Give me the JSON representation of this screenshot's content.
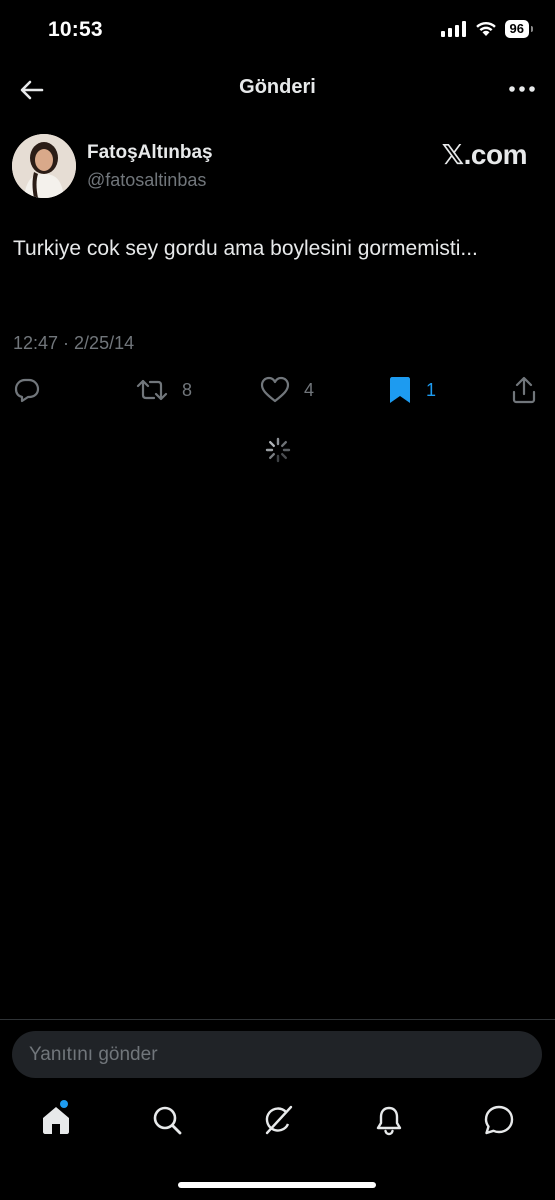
{
  "status_bar": {
    "time": "10:53",
    "battery": "96"
  },
  "header": {
    "title": "Gönderi"
  },
  "post": {
    "author_name": "FatoşAltınbaş",
    "author_handle": "@fatosaltinbas",
    "brand": "𝕏.com",
    "text": "Turkiye cok sey gordu ama boylesini gormemisti...",
    "timestamp": "12:47 · 2/25/14"
  },
  "actions": {
    "retweets": "8",
    "likes": "4",
    "bookmarks": "1"
  },
  "composer": {
    "placeholder": "Yanıtını gönder"
  },
  "colors": {
    "accent": "#1d9bf0",
    "muted": "#71767b",
    "background": "#000000"
  }
}
